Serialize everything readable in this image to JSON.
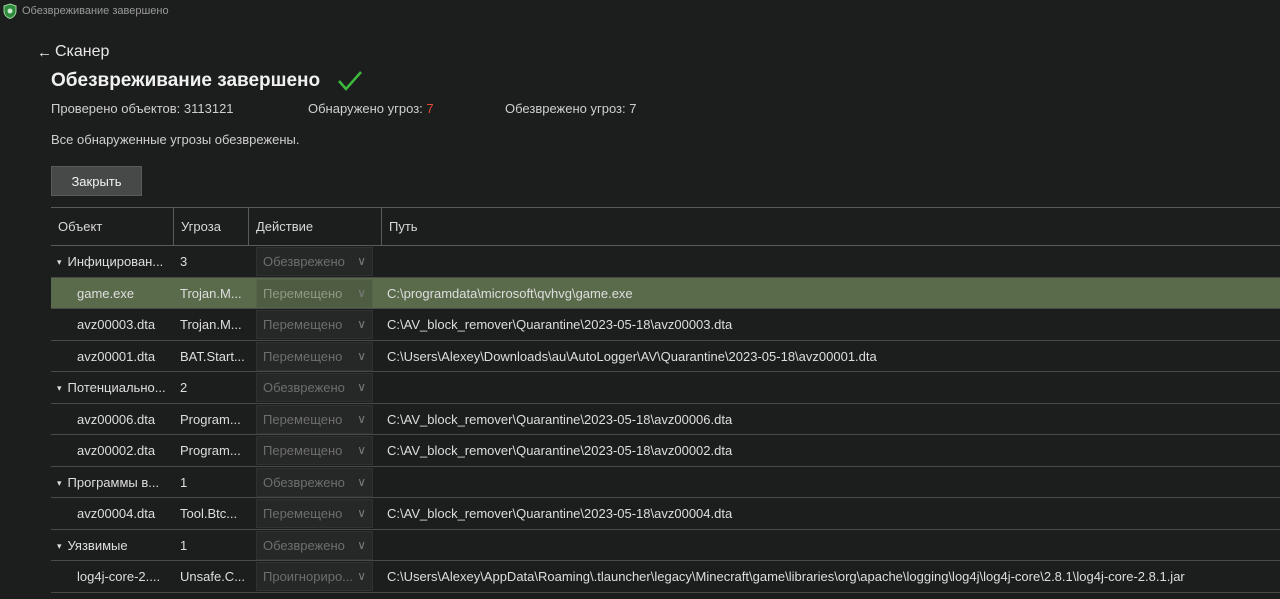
{
  "window": {
    "title": "Обезвреживание завершено"
  },
  "nav": {
    "back_label": "Сканер"
  },
  "heading": "Обезвреживание завершено",
  "stats": {
    "scanned_label": "Проверено объектов:",
    "scanned_value": "3113121",
    "detected_label": "Обнаружено угроз:",
    "detected_value": "7",
    "neutralized_label": "Обезврежено угроз:",
    "neutralized_value": "7"
  },
  "message": "Все обнаруженные угрозы обезврежены.",
  "close_button": "Закрыть",
  "columns": {
    "object": "Объект",
    "threat": "Угроза",
    "action": "Действие",
    "path": "Путь"
  },
  "rows": [
    {
      "type": "group",
      "object": "Инфицирован...",
      "count": "3",
      "action": "Обезврежено",
      "path": ""
    },
    {
      "type": "item",
      "selected": true,
      "object": "game.exe",
      "threat": "Trojan.M...",
      "action": "Перемещено",
      "path": "C:\\programdata\\microsoft\\qvhvg\\game.exe"
    },
    {
      "type": "item",
      "object": "avz00003.dta",
      "threat": "Trojan.M...",
      "action": "Перемещено",
      "path": "C:\\AV_block_remover\\Quarantine\\2023-05-18\\avz00003.dta"
    },
    {
      "type": "item",
      "object": "avz00001.dta",
      "threat": "BAT.Start...",
      "action": "Перемещено",
      "path": "C:\\Users\\Alexey\\Downloads\\au\\AutoLogger\\AV\\Quarantine\\2023-05-18\\avz00001.dta"
    },
    {
      "type": "group",
      "object": "Потенциально...",
      "count": "2",
      "action": "Обезврежено",
      "path": ""
    },
    {
      "type": "item",
      "object": "avz00006.dta",
      "threat": "Program...",
      "action": "Перемещено",
      "path": "C:\\AV_block_remover\\Quarantine\\2023-05-18\\avz00006.dta"
    },
    {
      "type": "item",
      "object": "avz00002.dta",
      "threat": "Program...",
      "action": "Перемещено",
      "path": "C:\\AV_block_remover\\Quarantine\\2023-05-18\\avz00002.dta"
    },
    {
      "type": "group",
      "object": "Программы в...",
      "count": "1",
      "action": "Обезврежено",
      "path": ""
    },
    {
      "type": "item",
      "object": "avz00004.dta",
      "threat": "Tool.Btc...",
      "action": "Перемещено",
      "path": "C:\\AV_block_remover\\Quarantine\\2023-05-18\\avz00004.dta"
    },
    {
      "type": "group",
      "object": "Уязвимые",
      "count": "1",
      "action": "Обезврежено",
      "path": ""
    },
    {
      "type": "item",
      "object": "log4j-core-2....",
      "threat": "Unsafe.C...",
      "action": "Проигнориро...",
      "path": "C:\\Users\\Alexey\\AppData\\Roaming\\.tlauncher\\legacy\\Minecraft\\game\\libraries\\org\\apache\\logging\\log4j\\log4j-core\\2.8.1\\log4j-core-2.8.1.jar"
    }
  ],
  "colors": {
    "accent_check": "#3dbb3d",
    "danger": "#e04a3a",
    "selected_row": "#5a6b4c"
  }
}
